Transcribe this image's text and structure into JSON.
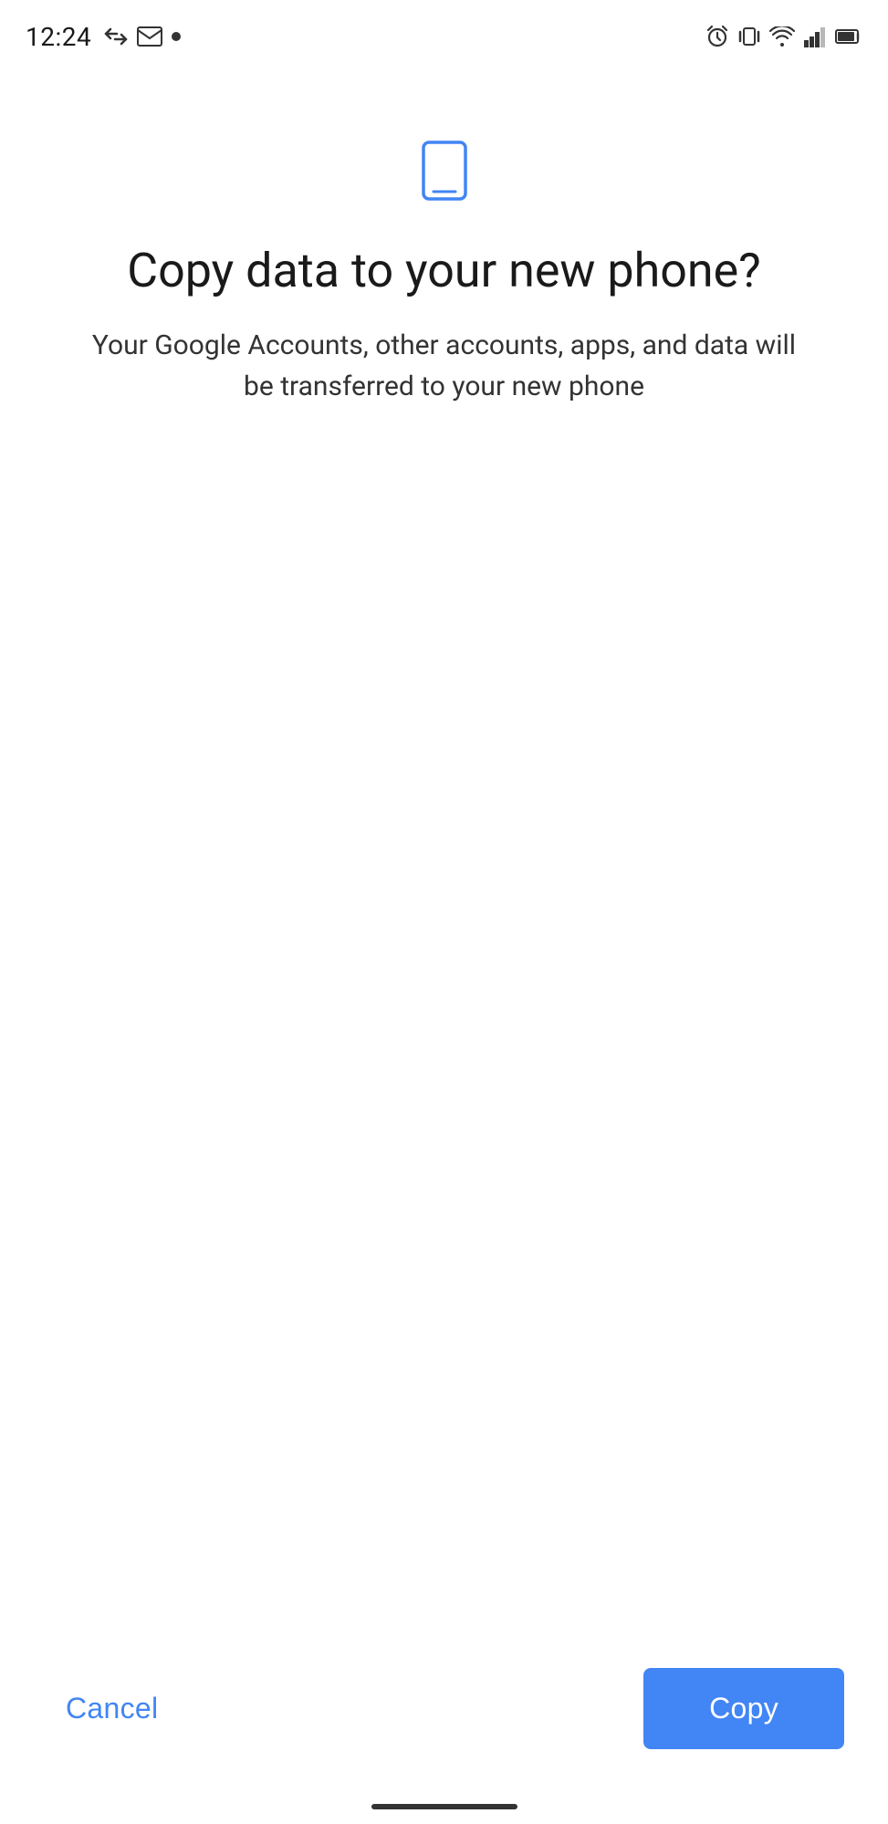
{
  "statusBar": {
    "time": "12:24",
    "leftIcons": [
      "arrows-icon",
      "gmail-icon",
      "dot-icon"
    ],
    "rightIcons": [
      "alarm-icon",
      "vibrate-icon",
      "wifi-icon",
      "signal-icon",
      "battery-icon"
    ]
  },
  "page": {
    "phoneIconColor": "#4285f4",
    "title": "Copy data to your new phone?",
    "subtitle": "Your Google Accounts, other accounts, apps, and data will be transferred to your new phone"
  },
  "buttons": {
    "cancel_label": "Cancel",
    "copy_label": "Copy",
    "cancel_color": "#4285f4",
    "copy_bg_color": "#4285f4",
    "copy_text_color": "#ffffff"
  }
}
